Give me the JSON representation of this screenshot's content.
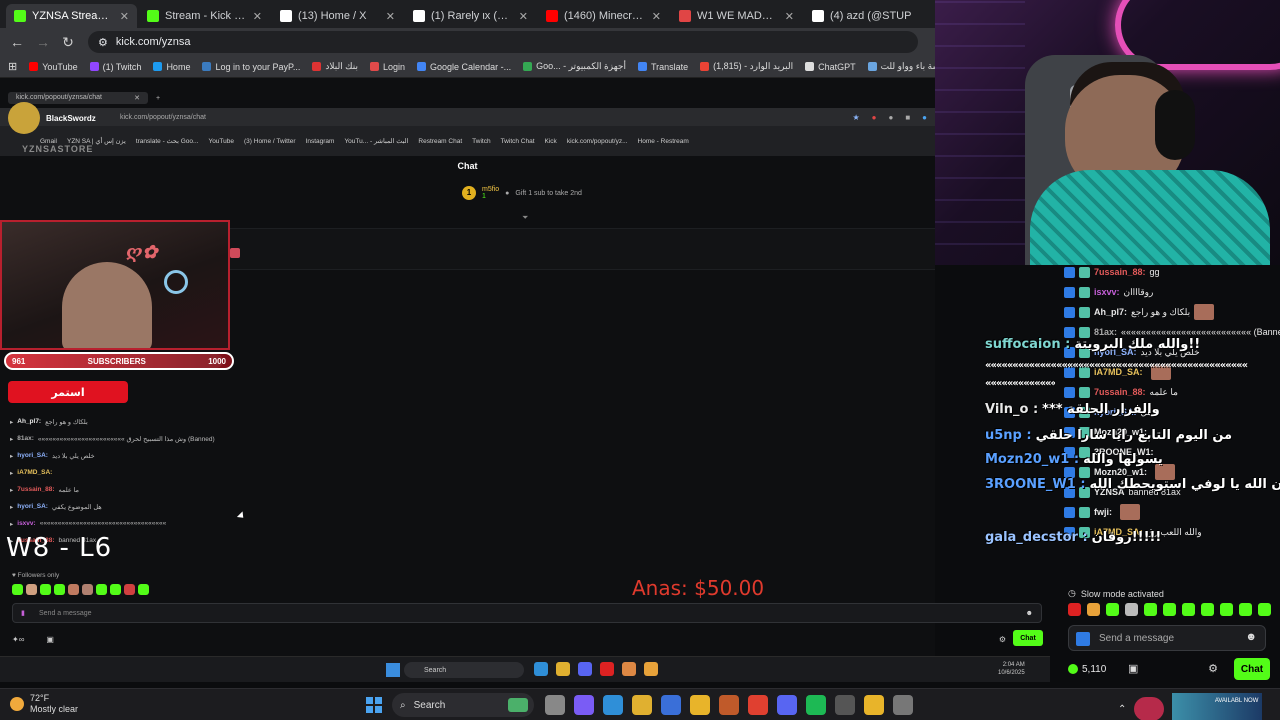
{
  "browser": {
    "tabs": [
      {
        "title": "YZNSA Stream - Wat",
        "color": "#53fc18",
        "active": true
      },
      {
        "title": "Stream - Kick Dashboard",
        "color": "#53fc18",
        "active": false
      },
      {
        "title": "(13) Home / X",
        "color": "#ffffff",
        "active": false
      },
      {
        "title": "(1) Rarely ιx (@1iFairy) / X",
        "color": "#ffffff",
        "active": false
      },
      {
        "title": "(1460) Minecraft Parkour",
        "color": "#ff0000",
        "active": false
      },
      {
        "title": "W1 WE MADE IT! T-shirt",
        "color": "#e04545",
        "active": false
      },
      {
        "title": "(4) azd (@STUP",
        "color": "#ffffff",
        "active": false
      }
    ],
    "url": "kick.com/yznsa",
    "bookmarks": [
      {
        "label": "YouTube",
        "color": "#ff0000"
      },
      {
        "label": "(1) Twitch",
        "color": "#9146ff"
      },
      {
        "label": "Home",
        "color": "#1d9bf0"
      },
      {
        "label": "Log in to your PayP...",
        "color": "#3b7bbf"
      },
      {
        "label": "بنك البلاد",
        "color": "#d33"
      },
      {
        "label": "Login",
        "color": "#e04a4a"
      },
      {
        "label": "Google Calendar -...",
        "color": "#4285f4"
      },
      {
        "label": "Goo... - أجهزة الكمبيوتر",
        "color": "#34a853"
      },
      {
        "label": "Translate",
        "color": "#4285f4"
      },
      {
        "label": "(1,815) - البريد الوارد",
        "color": "#ea4335"
      },
      {
        "label": "ChatGPT",
        "color": "#dddddd"
      },
      {
        "label": "مؤسسة باء وواو للت...",
        "color": "#6aa5e0"
      }
    ]
  },
  "inner": {
    "tab_title": "kick.com/popout/yznsa/chat",
    "url": "kick.com/popout/yznsa/chat",
    "streamer_name": "BlackSwordz",
    "store_label": "YZNSASTORE",
    "bookmarks": [
      "Gmail",
      "YZN SA | يزن إس أي",
      "translate - بحث Goo...",
      "YouTube",
      "(3) Home / Twitter",
      "Instagram",
      "YouTu... - البث المباشر",
      "Restream Chat",
      "Twitch",
      "Twitch Chat",
      "Kick",
      "kick.com/popout/yz...",
      "Home - Restream"
    ],
    "chat_title": "Chat",
    "pinned_rank": "1",
    "pinned_user": "m5fio",
    "pinned_count": "1",
    "pinned_text": "Gift 1 sub to take 2nd",
    "sub_goal": {
      "current": "961",
      "label": "SUBSCRIBERS",
      "target": "1000",
      "progress": 0.961
    },
    "arabic_button": "استمر",
    "chat_lines": [
      {
        "user": "Ah_pl7:",
        "text": "بلكاك و هو راجع",
        "color": "#e8e8e8"
      },
      {
        "user": "81ax:",
        "text": "«««««««««««««««««««««««« وش مذا التسبيح لحرق (Banned)",
        "color": "#aaaaaa"
      },
      {
        "user": "hyori_SA:",
        "text": "خلص يلي بلا ديد",
        "color": "#8fb4ff"
      },
      {
        "user": "iA7MD_SA:",
        "text": "",
        "color": "#e8c25c"
      },
      {
        "user": "7ussain_88:",
        "text": "ما علمه",
        "color": "#e25a5a"
      },
      {
        "user": "hyori_SA:",
        "text": "هل الموضوع يكفي",
        "color": "#8fb4ff"
      },
      {
        "user": "isxvv:",
        "text": "«««««««««««««««««««««««««««««««««««",
        "color": "#c55fd8"
      },
      {
        "user": "7ussain_88:",
        "text": "banned 81ax",
        "color": "#e25a5a"
      }
    ],
    "score": "W8 - L6",
    "followers_only": "Followers only",
    "input_placeholder": "Send a message",
    "chat_button": "Chat",
    "taskbar_search": "Search",
    "donation": "Anas: $50.00",
    "clock_time": "2:04 AM",
    "clock_date": "10/6/2025"
  },
  "right_chat": {
    "lines": [
      {
        "user": "7ussain_88:",
        "text": "gg",
        "color": "#e25a5a",
        "avatar": false
      },
      {
        "user": "isxvv:",
        "text": "روقاااان",
        "color": "#c55fd8",
        "avatar": false
      },
      {
        "user": "Ah_pl7:",
        "text": "بلكاك و هو راجع",
        "color": "#e8e8e8",
        "avatar": true
      },
      {
        "user": "81ax:",
        "text": "«««««««««««««««««««««««««« (Banned)",
        "color": "#aaaaaa",
        "avatar": false
      },
      {
        "user": "hyori_SA:",
        "text": "خلص يلي بلا ديد",
        "color": "#8fb4ff",
        "avatar": false
      },
      {
        "user": "iA7MD_SA:",
        "text": "",
        "color": "#e8c25c",
        "avatar": true
      },
      {
        "user": "7ussain_88:",
        "text": "ما علمه",
        "color": "#e25a5a",
        "avatar": false
      },
      {
        "user": "hyori_SA:",
        "text": "هل",
        "color": "#8fb4ff",
        "avatar": false
      },
      {
        "user": "Mozn20_w1:",
        "text": "",
        "color": "#e8e8e8",
        "avatar": false
      },
      {
        "user": "3ROONE_W1:",
        "text": "",
        "color": "#e8e8e8",
        "avatar": false
      },
      {
        "user": "Mozn20_w1:",
        "text": "",
        "color": "#e8e8e8",
        "avatar": true
      },
      {
        "user": "YZNSA",
        "text": "banned 81ax",
        "color": "#e8e8e8",
        "avatar": false
      },
      {
        "user": "fwji:",
        "text": "",
        "color": "#e8e8e8",
        "avatar": true
      },
      {
        "user": "iA7MD_SA:",
        "text": "والله اللعب زق",
        "color": "#e8c25c",
        "avatar": false
      }
    ],
    "big_lines": [
      {
        "user": "suffocaion :",
        "text": "والله ملك البرويتة!!",
        "color": "#7ed6d0"
      },
      {
        "user": "Viln_o :",
        "text": "*** والفرار الحلقة",
        "color": "#e8e8e8"
      },
      {
        "user": "u5np :",
        "text": "من اليوم التابع رايا سارا حلقي",
        "color": "#5aa0ff"
      },
      {
        "user": "Mozn20_w1 :",
        "text": "يسولها والله",
        "color": "#5aa0ff"
      },
      {
        "user": "3ROONE_W1 :",
        "text": "فدامان الله يا لوفي استويحطك الله",
        "color": "#5aa0ff"
      },
      {
        "user": "gala_decstor :",
        "text": "روقان!!!!!",
        "color": "#9ac3ff"
      }
    ],
    "spam_line": "««««««««««««««««««««««««««««««««««««««««««««««««",
    "slow_mode": "Slow mode activated",
    "input_placeholder": "Send a message",
    "points": "5,110",
    "chat_button": "Chat"
  },
  "taskbar": {
    "temperature": "72°F",
    "weather": "Mostly clear",
    "search": "Search",
    "ad_text": "AVAILABL NOW"
  },
  "colors": {
    "kick_green": "#53fc18",
    "red": "#d2232e"
  }
}
